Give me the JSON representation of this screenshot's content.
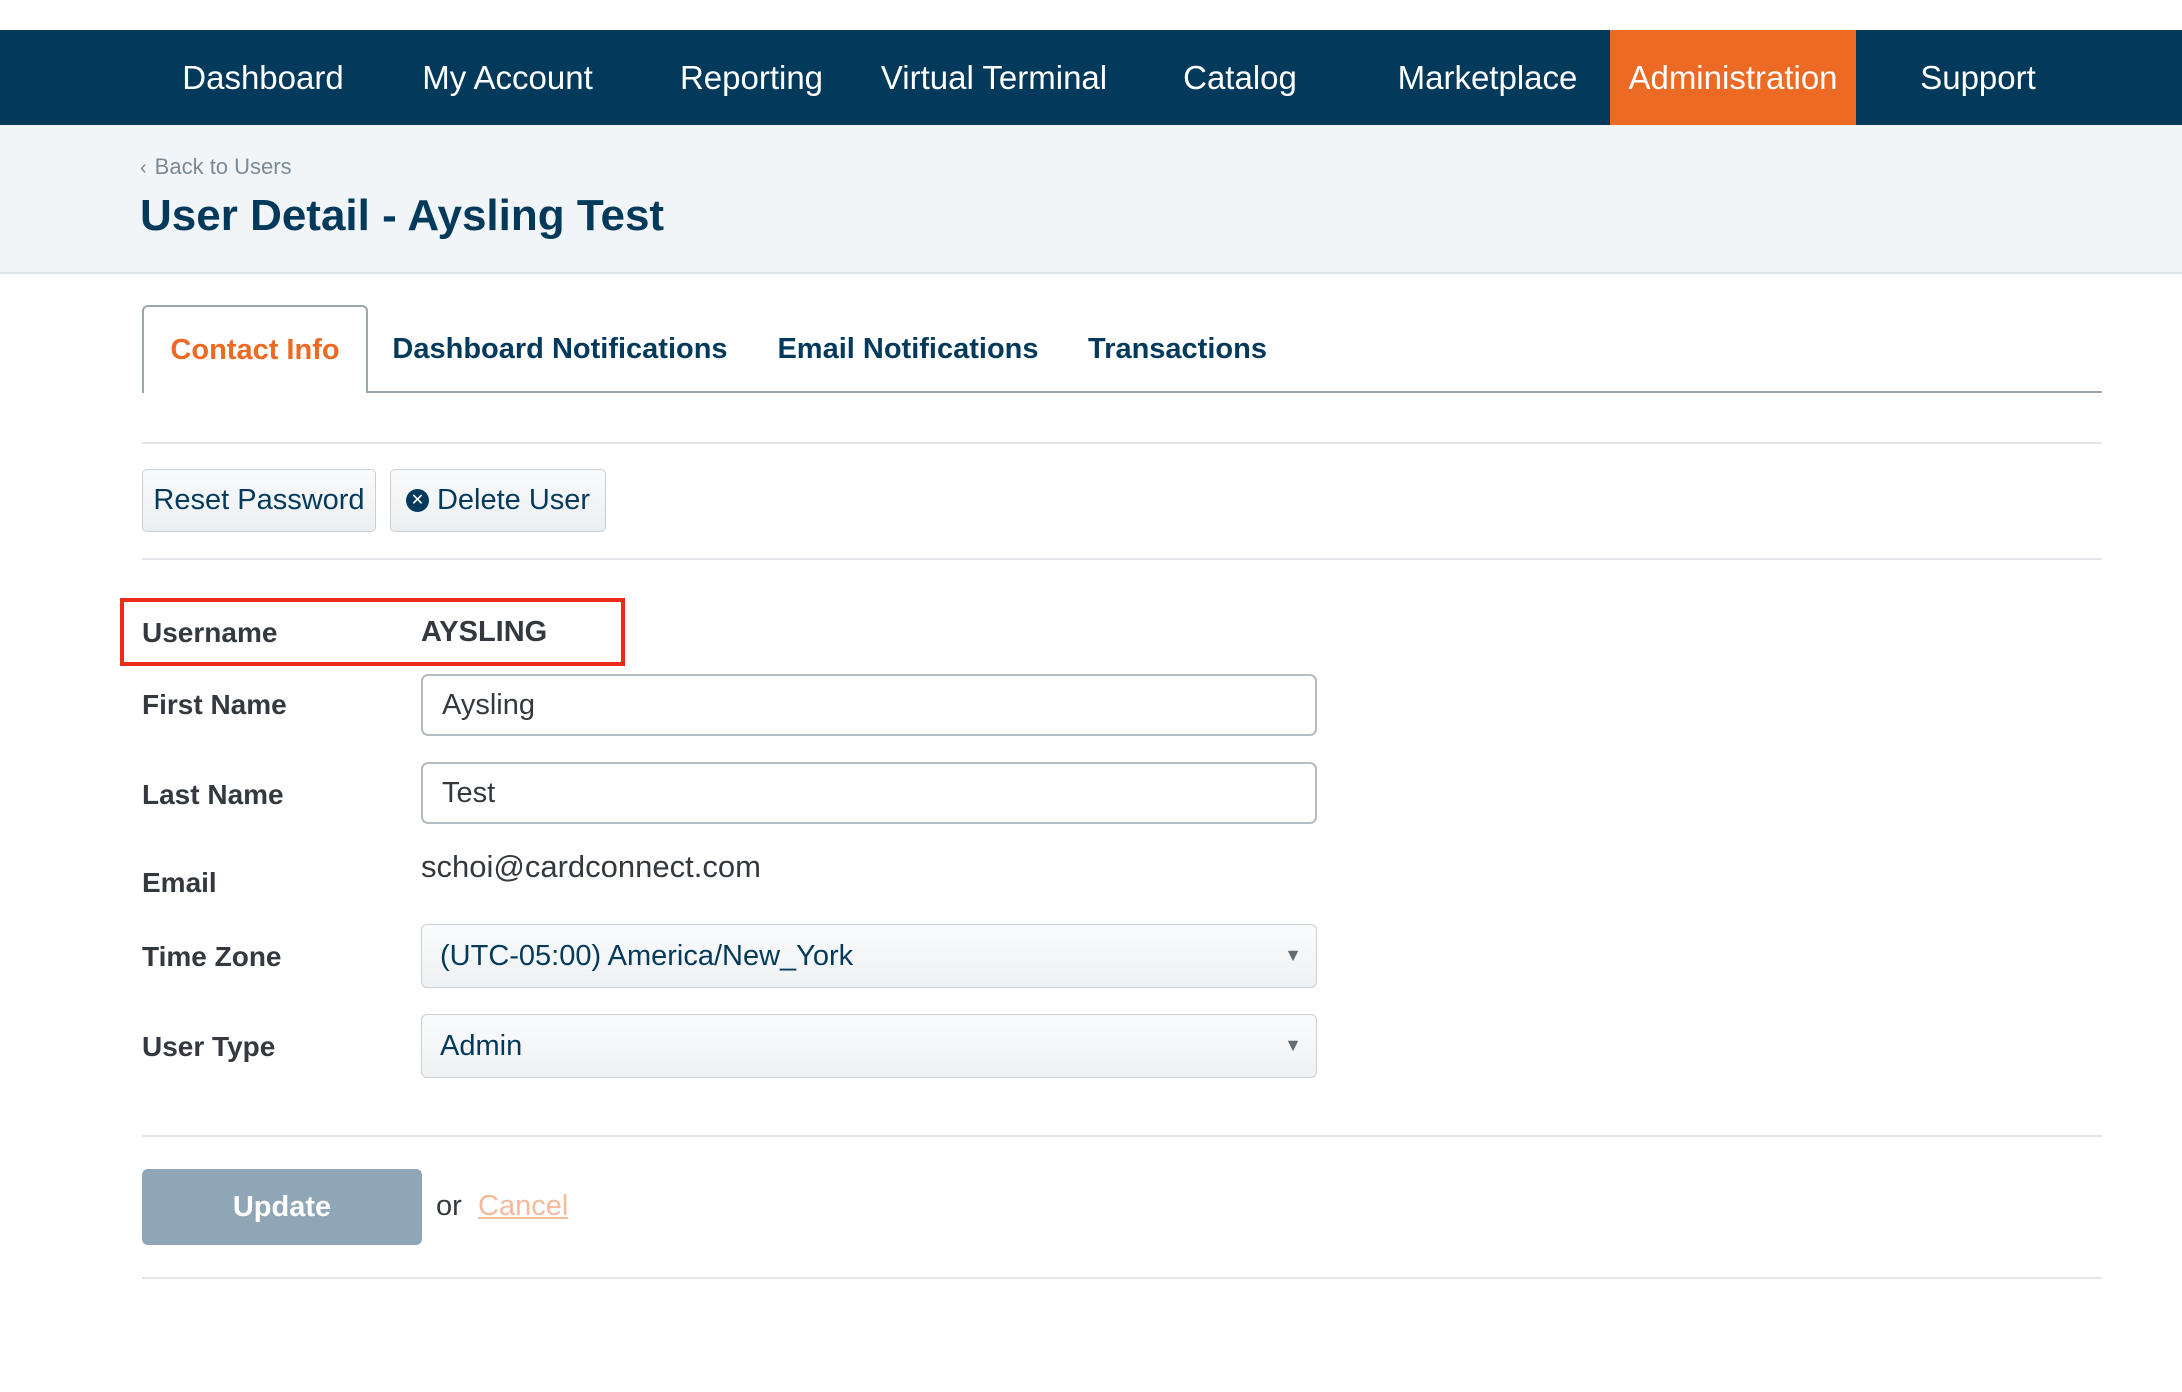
{
  "nav": {
    "items": [
      "Dashboard",
      "My Account",
      "Reporting",
      "Virtual Terminal",
      "Catalog",
      "Marketplace",
      "Administration",
      "Support"
    ],
    "active": "Administration"
  },
  "header": {
    "back_link": "Back to Users",
    "title": "User Detail - Aysling Test"
  },
  "tabs": {
    "items": [
      "Contact Info",
      "Dashboard Notifications",
      "Email Notifications",
      "Transactions"
    ],
    "active": "Contact Info"
  },
  "actions": {
    "reset_password": "Reset Password",
    "delete_user": "Delete User"
  },
  "form": {
    "username_label": "Username",
    "username_value": "AYSLING",
    "first_name_label": "First Name",
    "first_name_value": "Aysling",
    "last_name_label": "Last Name",
    "last_name_value": "Test",
    "email_label": "Email",
    "email_value": "schoi@cardconnect.com",
    "time_zone_label": "Time Zone",
    "time_zone_value": "(UTC-05:00) America/New_York",
    "user_type_label": "User Type",
    "user_type_value": "Admin"
  },
  "footer": {
    "update_label": "Update",
    "or_text": "or",
    "cancel_label": "Cancel"
  },
  "colors": {
    "nav_bg": "#033a5c",
    "accent": "#ec6a24",
    "highlight_box": "#ee2a1a"
  },
  "icons": {
    "back": "chevron-left-icon",
    "delete": "close-circle-icon",
    "select_caret": "caret-down-icon"
  }
}
